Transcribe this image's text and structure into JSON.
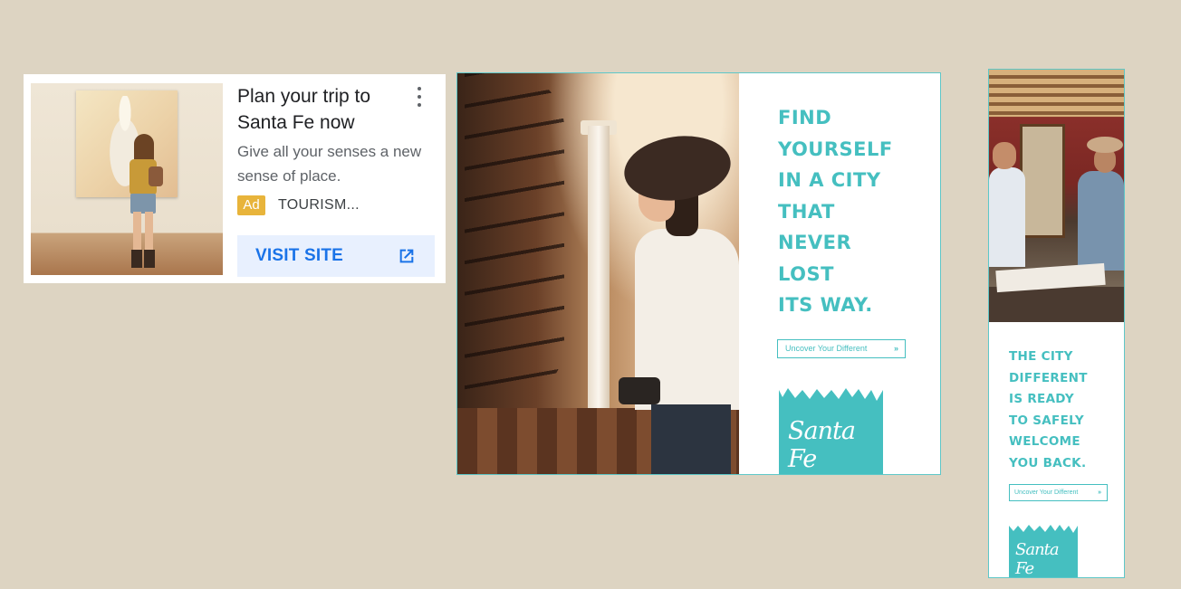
{
  "native_ad": {
    "title": "Plan your trip to Santa Fe now",
    "description": "Give all your senses a new sense of place.",
    "badge": "Ad",
    "advertiser": "TOURISM...",
    "cta_label": "VISIT SITE"
  },
  "rectangle_ad": {
    "tagline": [
      "FIND",
      "YOURSELF",
      "IN A CITY",
      "THAT",
      "NEVER",
      "LOST",
      "ITS WAY."
    ],
    "cta_label": "Uncover Your Different",
    "cta_chevron": "»",
    "logo_text": "Santa Fe"
  },
  "skyscraper_ad": {
    "tagline": [
      "THE CITY",
      "DIFFERENT",
      "IS READY",
      "TO SAFELY",
      "WELCOME",
      "YOU BACK."
    ],
    "cta_label": "Uncover Your Different",
    "cta_chevron": "»",
    "logo_text": "Santa Fe"
  },
  "colors": {
    "background": "#ddd4c2",
    "brand_teal": "#45bfc0",
    "link_blue": "#1a73e8",
    "ad_badge": "#e8b43b"
  },
  "icons": [
    "more-vert-icon",
    "open-in-new-icon",
    "double-chevron-right-icon"
  ]
}
